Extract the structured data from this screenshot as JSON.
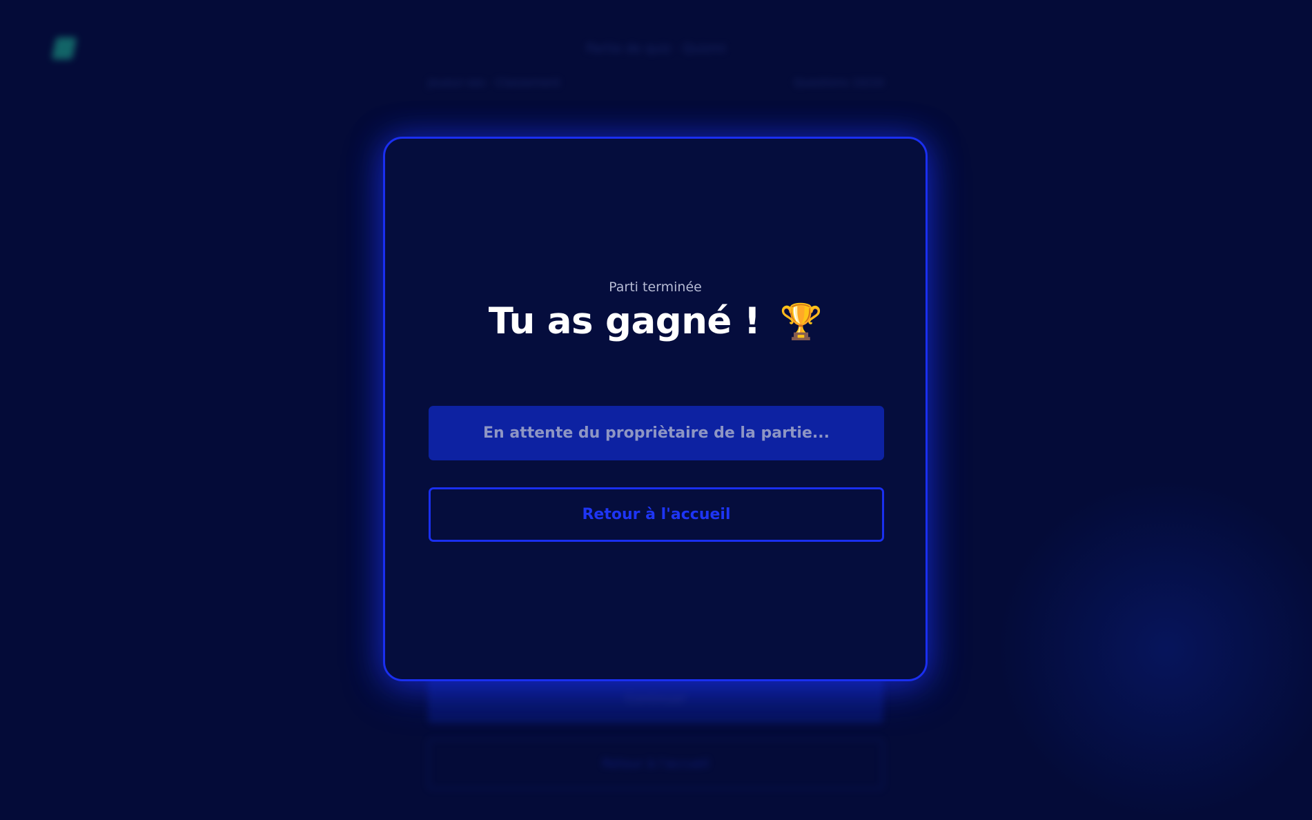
{
  "background": {
    "header_text": "Partie de quiz · Quizmi",
    "sub_left": "Joueur·ses · Classement",
    "sub_right": "Questions 10/10",
    "btn_filled_label": "Continuer",
    "btn_outline_label": "Retour à l'accueil"
  },
  "modal": {
    "subtitle": "Parti terminée",
    "title": "Tu as gagné !",
    "trophy_icon": "🏆",
    "waiting_button_label": "En attente du propriètaire de la partie...",
    "home_button_label": "Retour à l'accueil"
  },
  "colors": {
    "background": "#040b38",
    "accent": "#1a2ff0",
    "waiting_button": "#0d22a2",
    "logo": "#1fae8f"
  }
}
